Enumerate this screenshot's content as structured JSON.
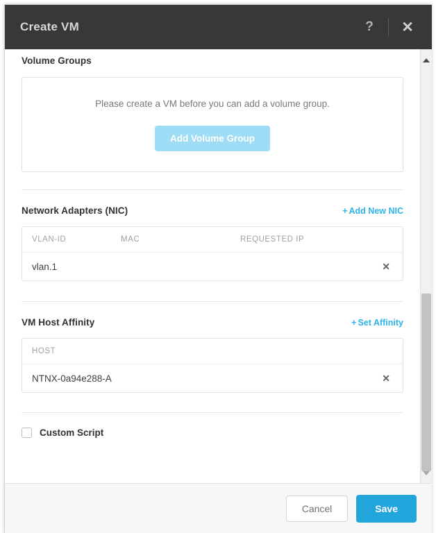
{
  "dialog": {
    "title": "Create VM",
    "help_icon": "?",
    "close_icon": "✕"
  },
  "volume_groups": {
    "label": "Volume Groups",
    "empty_message": "Please create a VM before you can add a volume group.",
    "add_button": "Add Volume Group",
    "add_button_disabled": true,
    "add_button_color": "#9fdcf5"
  },
  "network_adapters": {
    "label": "Network Adapters (NIC)",
    "add_link": "Add New NIC",
    "add_link_plus": "+",
    "columns": [
      "VLAN-ID",
      "MAC",
      "REQUESTED IP"
    ],
    "rows": [
      {
        "vlan_id": "vlan.1",
        "mac": "",
        "requested_ip": "",
        "remove_icon": "✕"
      }
    ]
  },
  "vm_host_affinity": {
    "label": "VM Host Affinity",
    "set_link": "Set Affinity",
    "set_link_plus": "+",
    "columns": [
      "HOST"
    ],
    "rows": [
      {
        "host": "NTNX-0a94e288-A",
        "remove_icon": "✕"
      }
    ]
  },
  "custom_script": {
    "label": "Custom Script",
    "checked": false
  },
  "footer": {
    "cancel_label": "Cancel",
    "save_label": "Save",
    "save_color": "#22a5db"
  },
  "scrollbar": {
    "up_arrow": "▲",
    "down_arrow": "▼"
  }
}
